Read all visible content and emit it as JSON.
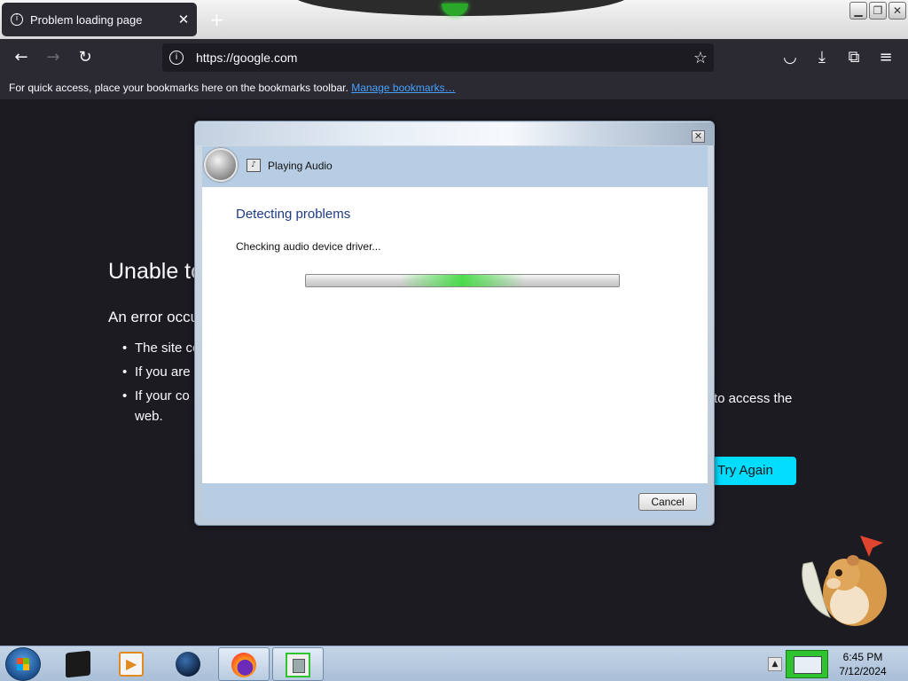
{
  "browser": {
    "tab": {
      "title": "Problem loading page",
      "info_icon": "info-icon",
      "close_glyph": "✕"
    },
    "new_tab_glyph": "+",
    "window_buttons": {
      "minimize": "▁",
      "restore": "❐",
      "close": "✕"
    },
    "nav": {
      "back": "←",
      "forward": "→",
      "reload": "↻"
    },
    "url": "https://google.com",
    "url_star": "☆",
    "toolbar_icons": {
      "pocket": "◡",
      "downloads": "⤓",
      "extensions": "⧉",
      "menu": "≡"
    },
    "bookmarks_bar": {
      "text": "For quick access, place your bookmarks here on the bookmarks toolbar.",
      "link": "Manage bookmarks…"
    }
  },
  "error_page": {
    "title": "Unable to",
    "subtitle": "An error occu",
    "bullets": [
      "The site co",
      "If you are",
      "If your co"
    ],
    "bullet3_tail": "to access the",
    "bullet3_wrap": "web.",
    "button": "Try Again"
  },
  "dialog": {
    "close_glyph": "✕",
    "header_title": "Playing Audio",
    "heading": "Detecting problems",
    "status": "Checking audio device driver...",
    "progress_glow_position": 0.5,
    "cancel": "Cancel"
  },
  "taskbar": {
    "clock_time": "6:45 PM",
    "clock_date": "7/12/2024",
    "tray_expand_glyph": "▲"
  },
  "colors": {
    "page_bg": "#1c1b22",
    "chrome_bg": "#2b2a33",
    "link": "#45a1ff",
    "try_again": "#00ddff",
    "dialog_heading": "#1e3a87"
  }
}
